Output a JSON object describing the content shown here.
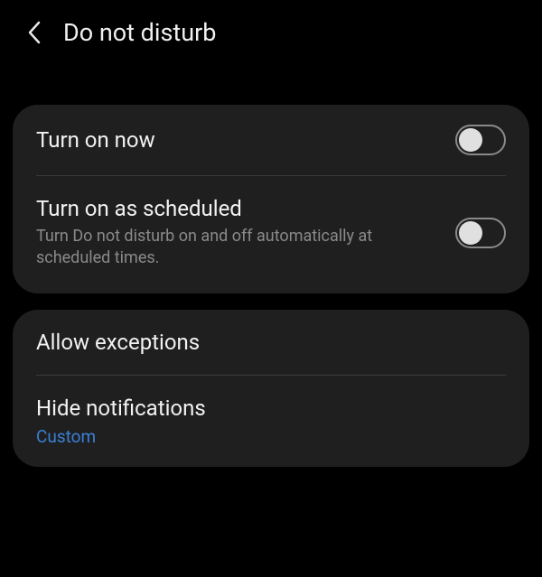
{
  "header": {
    "title": "Do not disturb"
  },
  "card1": {
    "turn_on_now": "Turn on now",
    "scheduled_title": "Turn on as scheduled",
    "scheduled_desc": "Turn Do not disturb on and off automatically at scheduled times."
  },
  "card2": {
    "allow_exceptions": "Allow exceptions",
    "hide_notifications": "Hide notifications",
    "hide_notifications_value": "Custom"
  }
}
